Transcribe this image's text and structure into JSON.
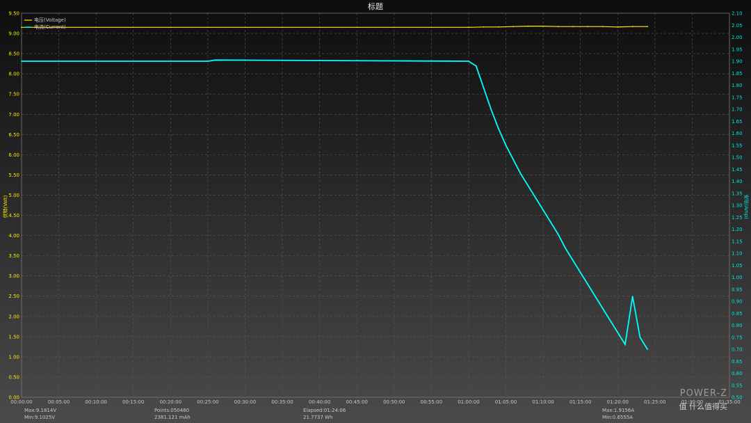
{
  "title": "标题",
  "legend": [
    {
      "label": "电压(Voltage)",
      "color": "#ffea00"
    },
    {
      "label": "电流(Current)",
      "color": "#00ffff"
    }
  ],
  "axes": {
    "y_left": {
      "label": "伏特(Volt)",
      "min": 0.0,
      "max": 9.5,
      "step": 0.5,
      "color": "#ffea00"
    },
    "y_right": {
      "label": "安培(Amp)",
      "min": 0.5,
      "max": 2.1,
      "step": 0.05,
      "color": "#00e5e5"
    },
    "x": {
      "min_min": 0,
      "max_min": 95,
      "step_min": 5
    }
  },
  "x_tick_labels": [
    "00:00:00",
    "00:05:00",
    "00:10:00",
    "00:15:00",
    "00:20:00",
    "00:25:00",
    "00:30:00",
    "00:35:00",
    "00:40:00",
    "00:45:00",
    "00:50:00",
    "00:55:00",
    "01:00:00",
    "01:05:00",
    "01:10:00",
    "01:15:00",
    "01:20:00",
    "01:25:00",
    "01:30:00",
    "01:35:00"
  ],
  "stats": {
    "v_max": "Max:9.1814V",
    "v_min": "Min:9.1025V",
    "points": "Points:050460",
    "capacity": "2381.121 mAh",
    "elapsed": "Elapsed:01:24:06",
    "energy": "21.7737 Wh",
    "a_max": "Max:1.9156A",
    "a_min": "Min:0.6555A"
  },
  "watermark": "POWER-Z",
  "watermark_sub": "值 什么值得买",
  "colors": {
    "voltage": "#ffea00",
    "current": "#00ffff",
    "grid": "#5a5a5a"
  },
  "chart_data": {
    "type": "line",
    "title": "标题",
    "xlabel": "",
    "ylabel": "伏特(Volt)",
    "ylabel_right": "安培(Amp)",
    "xlim_min": [
      0,
      95
    ],
    "ylim": [
      0,
      9.5
    ],
    "ylim_right": [
      0.5,
      2.1
    ],
    "grid": true,
    "legend_position": "top-left",
    "series": [
      {
        "name": "电压(Voltage)",
        "axis": "left",
        "x_min": [
          0,
          60,
          62,
          64,
          66,
          68,
          70,
          72,
          74,
          76,
          78,
          80,
          82,
          84
        ],
        "values": [
          9.15,
          9.15,
          9.16,
          9.16,
          9.17,
          9.18,
          9.18,
          9.17,
          9.17,
          9.17,
          9.17,
          9.16,
          9.17,
          9.17
        ]
      },
      {
        "name": "电流(Current)",
        "axis": "right",
        "x_min": [
          0,
          25,
          26,
          60,
          61,
          62,
          63,
          64,
          65,
          66,
          67,
          68,
          69,
          70,
          71,
          72,
          73,
          74,
          75,
          76,
          77,
          78,
          79,
          80,
          81,
          82,
          83,
          84
        ],
        "values": [
          1.9,
          1.9,
          1.905,
          1.9,
          1.88,
          1.79,
          1.7,
          1.62,
          1.55,
          1.49,
          1.43,
          1.38,
          1.33,
          1.28,
          1.23,
          1.18,
          1.12,
          1.07,
          1.02,
          0.97,
          0.92,
          0.87,
          0.82,
          0.77,
          0.72,
          0.92,
          0.75,
          0.7
        ]
      }
    ]
  }
}
